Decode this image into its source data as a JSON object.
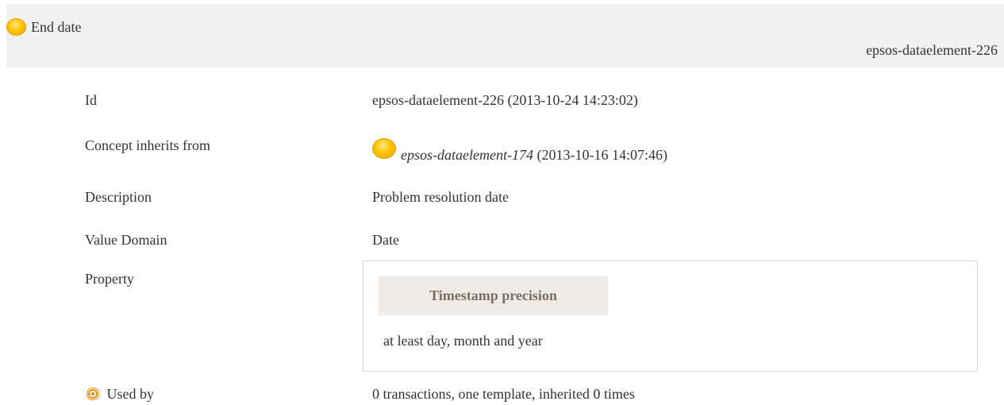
{
  "header": {
    "title": "End date",
    "id": "epsos-dataelement-226"
  },
  "rows": {
    "id": {
      "label": "Id",
      "value": "epsos-dataelement-226 (2013-10-24 14:23:02)"
    },
    "inherits": {
      "label": "Concept inherits from",
      "link": "epsos-dataelement-174",
      "date": "(2013-10-16 14:07:46)"
    },
    "description": {
      "label": "Description",
      "value": "Problem resolution date"
    },
    "value_domain": {
      "label": "Value Domain",
      "value": "Date"
    },
    "property": {
      "label": "Property",
      "name": "Timestamp precision",
      "value": "at least day, month and year"
    },
    "used_by": {
      "label": "Used by",
      "value": "0 transactions, one template, inherited 0 times"
    }
  },
  "colors": {
    "header_bg": "#f1f1f1",
    "status_dot": "#ffc400",
    "property_header_bg": "#efebe6"
  },
  "icons": {
    "status": "yellow-status-dot-icon",
    "used_by": "target-icon"
  }
}
